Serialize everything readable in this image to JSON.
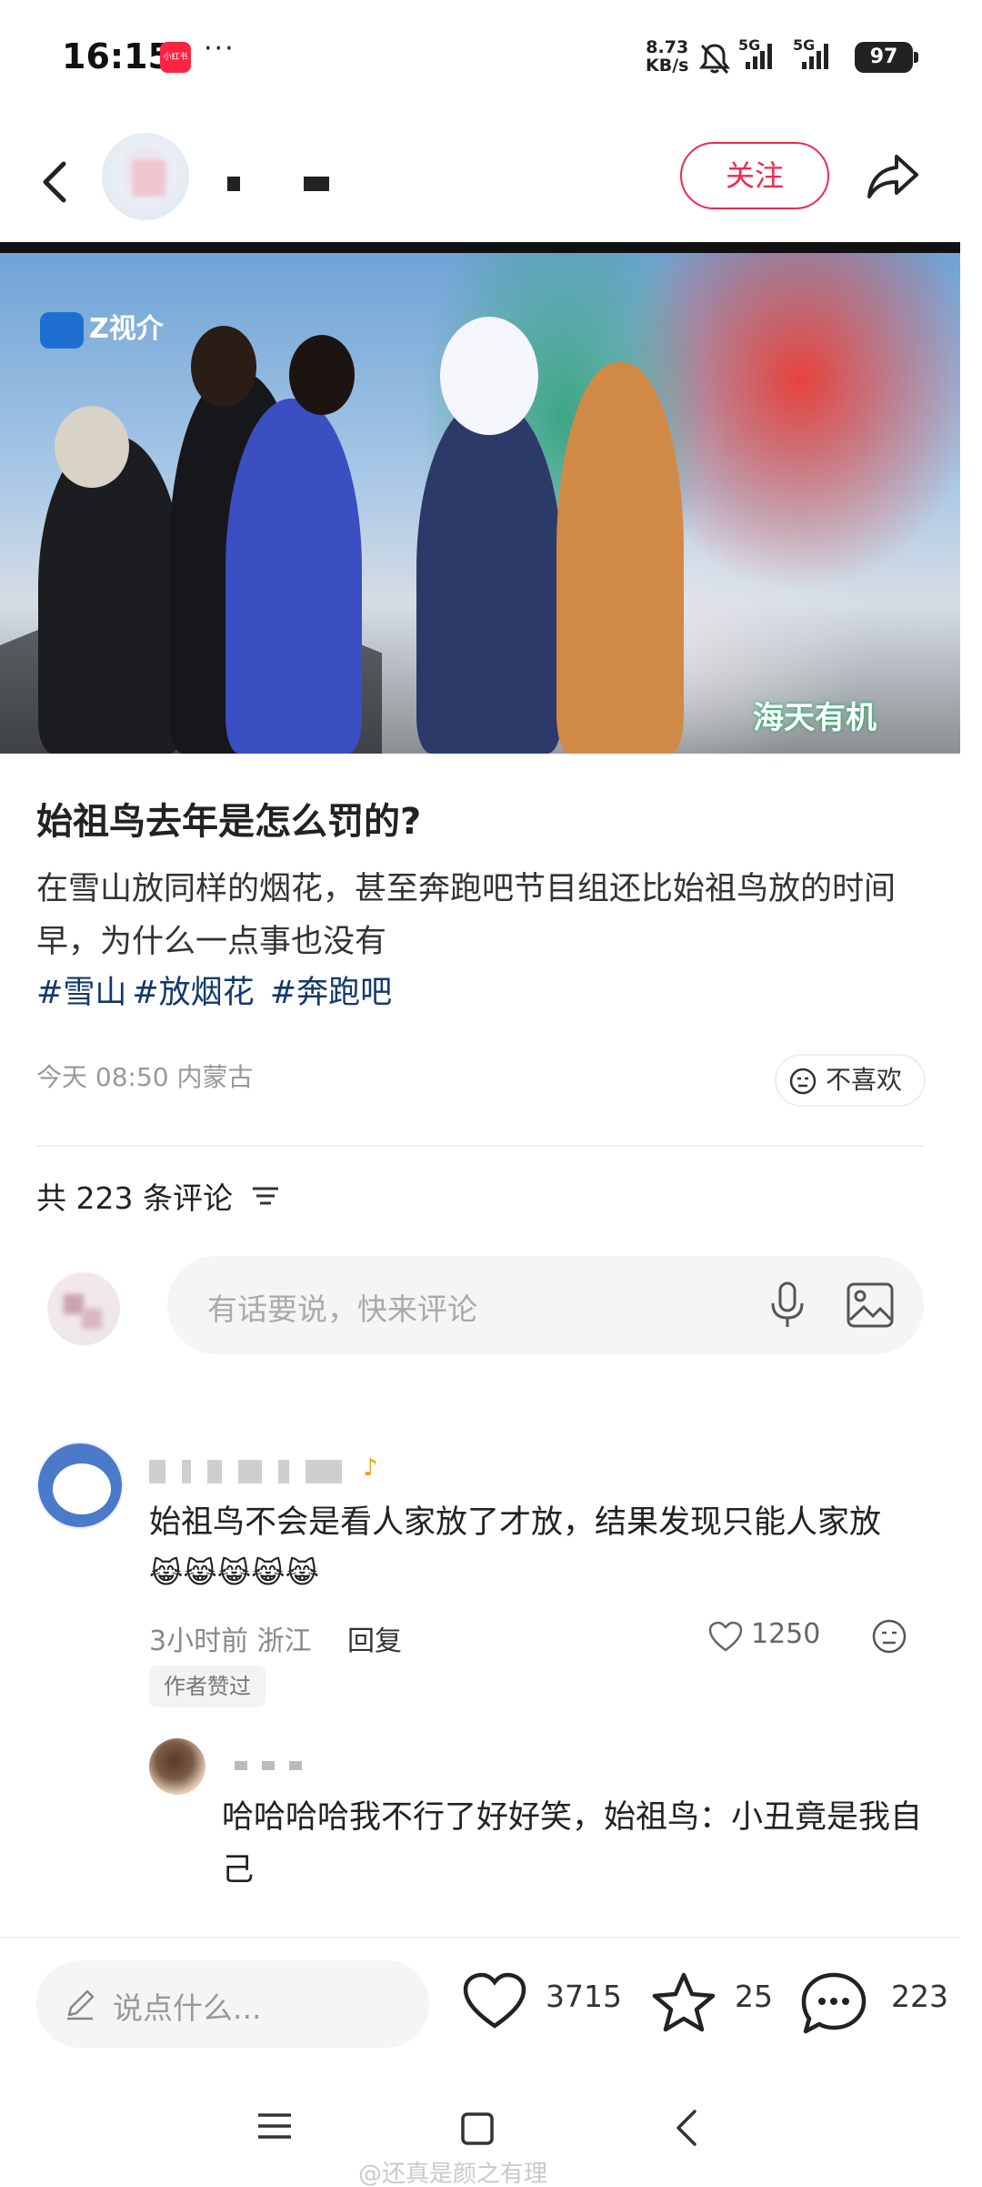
{
  "status_bar": {
    "time": "16:15",
    "app_badge": "小红书",
    "more": "···",
    "net_speed_value": "8.73",
    "net_speed_unit": "KB/s",
    "signal1_label": "5G",
    "signal2_label": "5G",
    "battery": "97"
  },
  "header": {
    "follow_label": "关注"
  },
  "hero_image": {
    "channel_logo": "Z视介",
    "sponsor_watermark": "海天有机"
  },
  "post": {
    "title": "始祖鸟去年是怎么罚的?",
    "body": "在雪山放同样的烟花，甚至奔跑吧节目组还比始祖鸟放的时间早，为什么一点事也没有",
    "tags": [
      "#雪山",
      "#放烟花",
      "#奔跑吧"
    ],
    "meta": "今天 08:50 内蒙古",
    "dislike_label": "不喜欢"
  },
  "comments": {
    "count_label": "共 223 条评论",
    "input_placeholder": "有话要说，快来评论",
    "items": [
      {
        "text": "始祖鸟不会是看人家放了才放，结果发现只能人家放",
        "emojis": "😹😹😹😹😹",
        "meta": "3小时前 浙江",
        "reply_label": "回复",
        "likes": "1250",
        "badge": "作者赞过",
        "reply": {
          "text": "哈哈哈哈我不行了好好笑，始祖鸟：小丑竟是我自己"
        }
      }
    ]
  },
  "bottom_bar": {
    "say_placeholder": "说点什么...",
    "likes": "3715",
    "stars": "25",
    "comments": "223"
  },
  "watermark": "@还真是颜之有理",
  "colors": {
    "accent": "#f0294b",
    "tag": "#13386c"
  }
}
